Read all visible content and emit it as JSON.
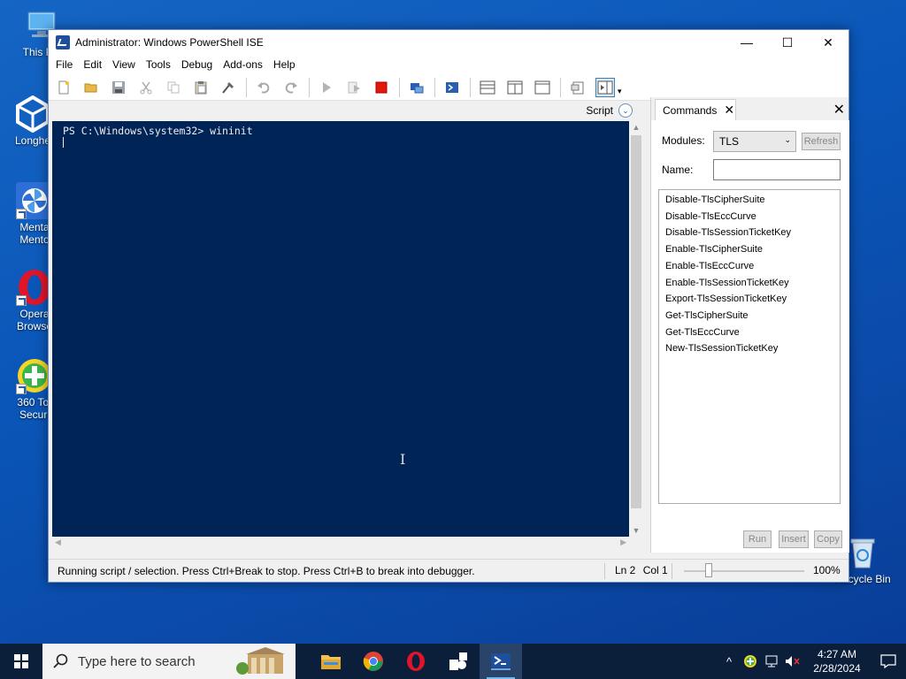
{
  "desktop": {
    "icons": [
      {
        "label": "This PC"
      },
      {
        "label": "Longhe"
      },
      {
        "label": "Menta Mento"
      },
      {
        "label": "Opera Browse"
      },
      {
        "label": "360 Tot Securi"
      },
      {
        "label": "Recycle Bin"
      }
    ]
  },
  "window": {
    "title": "Administrator: Windows PowerShell ISE",
    "controls": {
      "minimize": "—",
      "maximize": "☐",
      "close": "✕"
    },
    "menu": [
      "File",
      "Edit",
      "View",
      "Tools",
      "Debug",
      "Add-ons",
      "Help"
    ],
    "toolbar": {
      "buttons": [
        "new-script",
        "open",
        "save",
        "cut",
        "copy",
        "paste",
        "clear-console",
        "undo",
        "redo",
        "run-script",
        "run-selection",
        "stop",
        "new-remote-tab",
        "start-powershell",
        "script-pane-top",
        "script-pane-right",
        "script-pane-maximized",
        "show-script-pane",
        "show-command-addon"
      ]
    },
    "script_label": "Script",
    "console": {
      "lines": [
        "PS C:\\Windows\\system32> wininit"
      ]
    },
    "commands_pane": {
      "tab_label": "Commands",
      "modules_label": "Modules:",
      "modules_value": "TLS",
      "refresh_label": "Refresh",
      "name_label": "Name:",
      "name_value": "",
      "items": [
        "Disable-TlsCipherSuite",
        "Disable-TlsEccCurve",
        "Disable-TlsSessionTicketKey",
        "Enable-TlsCipherSuite",
        "Enable-TlsEccCurve",
        "Enable-TlsSessionTicketKey",
        "Export-TlsSessionTicketKey",
        "Get-TlsCipherSuite",
        "Get-TlsEccCurve",
        "New-TlsSessionTicketKey"
      ],
      "run_label": "Run",
      "insert_label": "Insert",
      "copy_label": "Copy"
    },
    "status": {
      "message": "Running script / selection.  Press Ctrl+Break to stop.  Press Ctrl+B to break into debugger.",
      "line": "Ln 2",
      "col": "Col 1",
      "zoom": "100%"
    }
  },
  "taskbar": {
    "search_placeholder": "Type here to search",
    "apps": [
      "file-explorer",
      "chrome",
      "opera",
      "app-4",
      "powershell-ise"
    ],
    "clock_time": "4:27 AM",
    "clock_date": "2/28/2024"
  },
  "colors": {
    "console_bg": "#012456",
    "console_fg": "#eeedf0",
    "desktop_bg": "#0a56b8",
    "taskbar_bg": "#0b1f3b"
  }
}
